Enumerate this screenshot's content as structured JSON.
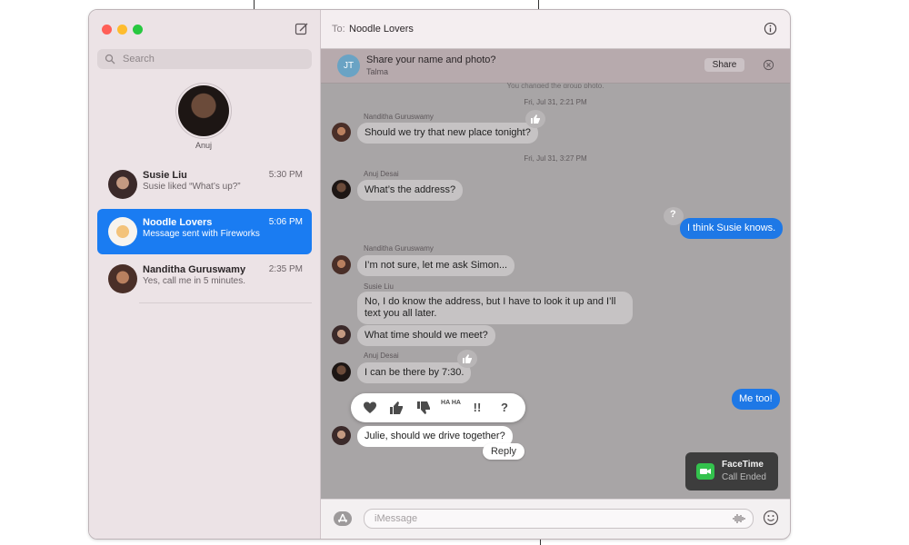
{
  "sidebar": {
    "search_placeholder": "Search",
    "pinned": {
      "name": "Anuj"
    },
    "conversations": [
      {
        "name": "Susie Liu",
        "time": "5:30 PM",
        "preview": "Susie liked “What’s up?”"
      },
      {
        "name": "Noodle Lovers",
        "time": "5:06 PM",
        "preview": "Message sent with Fireworks",
        "selected": true
      },
      {
        "name": "Nanditha Guruswamy",
        "time": "2:35 PM",
        "preview": "Yes, call me in 5 minutes."
      }
    ]
  },
  "header": {
    "to_label": "To:",
    "recipient": "Noodle Lovers"
  },
  "share_banner": {
    "avatar_initials": "JT",
    "prompt": "Share your name and photo?",
    "name": "Talma",
    "share_label": "Share",
    "overlap_text": "You changed the group photo."
  },
  "thread": {
    "timestamps": [
      "Fri, Jul 31, 2:21 PM",
      "Fri, Jul 31, 3:27 PM"
    ],
    "senders": [
      "Nanditha Guruswamy",
      "Anuj Desai",
      "Nanditha Guruswamy",
      "Susie Liu",
      "Anuj Desai"
    ],
    "messages": [
      "Should we try that new place tonight?",
      "What’s the address?",
      "I think Susie knows.",
      "I’m not sure, let me ask Simon...",
      "No, I do know the address, but I have to look it up and I’ll text you all later.",
      "What time should we meet?",
      "I can be there by 7:30.",
      "Me too!",
      "Julie, should we drive together?"
    ],
    "reply_label": "Reply"
  },
  "tapbacks": [
    "heart",
    "thumbs-up",
    "thumbs-down",
    "haha",
    "!!",
    "?"
  ],
  "tapback_text": {
    "haha": "HA HA",
    "emphasize": "!!",
    "question": "?"
  },
  "facetime": {
    "title": "FaceTime",
    "status": "Call Ended"
  },
  "composer": {
    "placeholder": "iMessage"
  },
  "colors": {
    "selected": "#1a7cf2",
    "outgoing_bubble": "#1e78e6",
    "facetime_green": "#33c24d"
  }
}
